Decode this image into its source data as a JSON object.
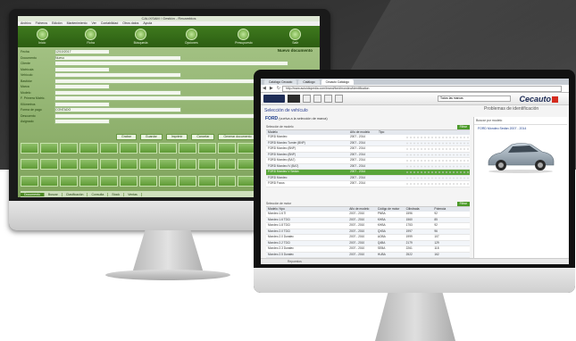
{
  "monitor1": {
    "window_title": "CALIXSAM / Gestión - Recambios",
    "menu": [
      "Archivo",
      "Ficheros",
      "Edición",
      "Mantenimiento",
      "Ver",
      "Contabilidad",
      "Otros datos",
      "Ayuda"
    ],
    "toolbar": [
      "Inicio",
      "Ficha",
      "Búsqueda",
      "Opciones",
      "Presupuesto",
      "Salir"
    ],
    "right_title": "Nuevo documento",
    "form_rows": [
      {
        "label": "Fecha",
        "value": "12/10/2017"
      },
      {
        "label": "Documento",
        "value": "Nuevo"
      },
      {
        "label": "Cliente",
        "value": ""
      },
      {
        "label": "Matrícula",
        "value": ""
      },
      {
        "label": "Vehículo",
        "value": ""
      },
      {
        "label": "Bastidor",
        "value": ""
      },
      {
        "label": "Marca",
        "value": ""
      },
      {
        "label": "Modelo",
        "value": ""
      },
      {
        "label": "F. Primera Matric.",
        "value": ""
      },
      {
        "label": "Kilómetros",
        "value": ""
      },
      {
        "label": "Forma de pago",
        "value": "CONTADO"
      },
      {
        "label": "Descuento",
        "value": ""
      },
      {
        "label": "Asignado",
        "value": ""
      }
    ],
    "buttons": [
      "Grabar",
      "Guardar",
      "Imprimir",
      "Cancelar",
      "Generar documento"
    ],
    "grid_cells": 45,
    "tabs": [
      "Documento",
      "Buscar",
      "Clasificación",
      "Consulta",
      "Stock",
      "Ventas"
    ],
    "active_tab_index": 0
  },
  "monitor2": {
    "browser_tabs": [
      "Catálogo Cecauto",
      "Catálogo",
      "Cecauto Catálogo"
    ],
    "active_browser_tab_index": 2,
    "url": "http://www.autoidiopedia.com/brand/ford/mondeo/identification",
    "brand": "Cecauto",
    "toolbar_dropdown": "Todos las marcas",
    "section_title": "Selección de vehículo",
    "right_title": "Problemas de identificación",
    "make": "FORD",
    "make_note": "(vuelva a la selección de marca)",
    "panel1": {
      "header": "Selección de modelo",
      "badge": "Filtrar",
      "columns": [
        "Modelo",
        "Año de modelo",
        "Tipo"
      ],
      "rows": [
        {
          "model": "FORD Mondeo",
          "years": "2007 - 2014",
          "type": "",
          "sel": false
        },
        {
          "model": "FORD Mondeo Turnier (BNP)",
          "years": "2007 - 2014",
          "type": "",
          "sel": false
        },
        {
          "model": "FORD Mondeo (BNP)",
          "years": "2007 - 2014",
          "type": "",
          "sel": false
        },
        {
          "model": "FORD Mondeo (BNP)",
          "years": "2007 - 2014",
          "type": "",
          "sel": false
        },
        {
          "model": "FORD Mondeo (BA7)",
          "years": "2007 - 2014",
          "type": "",
          "sel": false
        },
        {
          "model": "FORD Mondeo IV (BA7)",
          "years": "2007 - 2014",
          "type": "",
          "sel": false
        },
        {
          "model": "FORD Mondeo V Sedán",
          "years": "2007 - 2014",
          "type": "",
          "sel": true
        },
        {
          "model": "FORD Mondeo",
          "years": "2007 - 2014",
          "type": "",
          "sel": false
        },
        {
          "model": "FORD Focus",
          "years": "2007 - 2014",
          "type": "",
          "sel": false
        }
      ]
    },
    "panel2": {
      "header": "Selección de motor",
      "badge": "Filtrar",
      "columns": [
        "Modelo / tipo",
        "Año de modelo",
        "Código de motor",
        "Cilindrada",
        "Potencia"
      ],
      "rows": [
        {
          "model": "Mondeo 1.6 Ti",
          "years": "2007 - 2010",
          "code": "PNBA",
          "cc": "1596",
          "kw": "92"
        },
        {
          "model": "Mondeo 1.6 TDCi",
          "years": "2007 - 2010",
          "code": "KHBA",
          "cc": "1560",
          "kw": "85"
        },
        {
          "model": "Mondeo 1.8 TDCi",
          "years": "2007 - 2010",
          "code": "KHBA",
          "cc": "1753",
          "kw": "92"
        },
        {
          "model": "Mondeo 2.0 TDCi",
          "years": "2007 - 2010",
          "code": "QXBA",
          "cc": "1997",
          "kw": "96"
        },
        {
          "model": "Mondeo 2.0 Duratec",
          "years": "2007 - 2010",
          "code": "AOBA",
          "cc": "1999",
          "kw": "107"
        },
        {
          "model": "Mondeo 2.2 TDCi",
          "years": "2007 - 2010",
          "code": "Q4BA",
          "cc": "2179",
          "kw": "129"
        },
        {
          "model": "Mondeo 2.3 Duratec",
          "years": "2007 - 2010",
          "code": "SEBA",
          "cc": "2261",
          "kw": "118"
        },
        {
          "model": "Mondeo 2.5 Duratec",
          "years": "2007 - 2010",
          "code": "HUBA",
          "cc": "2522",
          "kw": "162"
        },
        {
          "model": "Mondeo 2.5 Turbo",
          "years": "2007 - 2010",
          "code": "HUBA",
          "cc": "2522",
          "kw": "162"
        },
        {
          "model": "Mondeo 2.0 EcoBoost",
          "years": "2010 - 2014",
          "code": "TPBA",
          "cc": "1999",
          "kw": "149"
        }
      ]
    },
    "right_panel_head": "Buscar por modelo",
    "right_model": "FORD Mondeo Sedán 2007 - 2014",
    "status": "Repuestos"
  },
  "colors": {
    "green_dark": "#2c5d12",
    "green_select": "#59a53a",
    "brand_blue": "#1b2a55",
    "brand_red": "#d52b1e"
  }
}
